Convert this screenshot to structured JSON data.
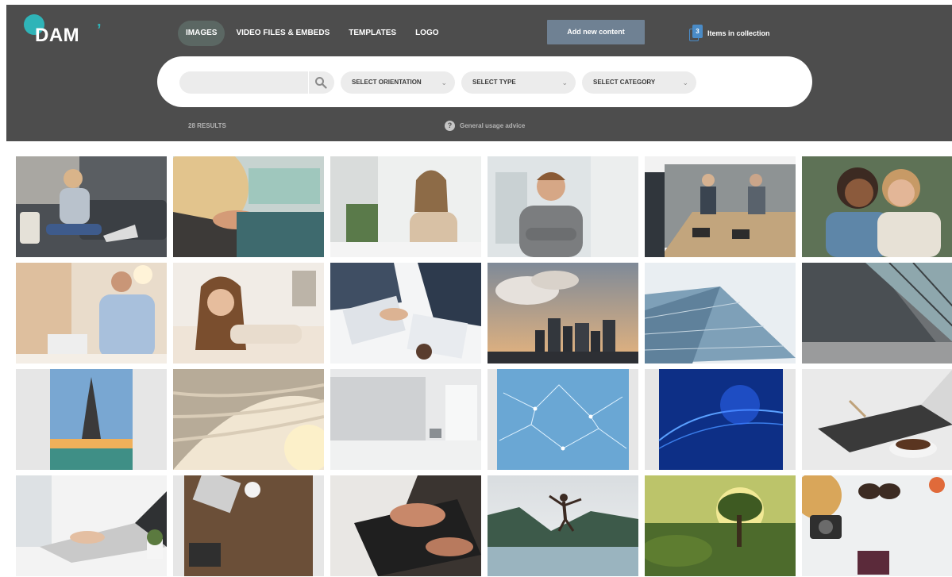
{
  "brand": {
    "logo_text": "DAM"
  },
  "nav": {
    "items": [
      {
        "label": "IMAGES",
        "active": true
      },
      {
        "label": "VIDEO FILES & EMBEDS",
        "active": false
      },
      {
        "label": "TEMPLATES",
        "active": false
      },
      {
        "label": "LOGO",
        "active": false
      }
    ]
  },
  "actions": {
    "add_content_label": "Add new content"
  },
  "collection": {
    "count": "3",
    "label": "Items in collection"
  },
  "search": {
    "value": "",
    "placeholder": "",
    "filters": [
      {
        "label": "SELECT ORIENTATION"
      },
      {
        "label": "SELECT TYPE"
      },
      {
        "label": "SELECT CATEGORY"
      }
    ]
  },
  "results": {
    "count_label": "28 RESULTS",
    "advice_label": "General usage advice"
  },
  "colors": {
    "header_bg": "#4d4d4d",
    "accent": "#2fb4b8",
    "button": "#6f8193",
    "collection_icon": "#4a8bc6"
  },
  "gallery": {
    "images": [
      {
        "subject": "woman-with-laptop-on-sofa"
      },
      {
        "subject": "hands-typing-on-laptop"
      },
      {
        "subject": "smiling-woman-at-desk"
      },
      {
        "subject": "man-with-crossed-arms"
      },
      {
        "subject": "office-team-meeting"
      },
      {
        "subject": "two-laughing-women"
      },
      {
        "subject": "man-with-laptop"
      },
      {
        "subject": "woman-lying-on-bed"
      },
      {
        "subject": "business-paperwork"
      },
      {
        "subject": "city-skyline-clouds"
      },
      {
        "subject": "glass-building-sky"
      },
      {
        "subject": "glass-architecture"
      },
      {
        "subject": "eiffel-tower"
      },
      {
        "subject": "curved-white-structure"
      },
      {
        "subject": "empty-white-room"
      },
      {
        "subject": "light-blue-network"
      },
      {
        "subject": "dark-blue-network"
      },
      {
        "subject": "laptop-and-coffee"
      },
      {
        "subject": "hands-on-laptop-white"
      },
      {
        "subject": "desk-from-above"
      },
      {
        "subject": "typing-closeup"
      },
      {
        "subject": "jumping-person-lake"
      },
      {
        "subject": "tree-at-sunrise"
      },
      {
        "subject": "travel-flatlay"
      }
    ]
  }
}
